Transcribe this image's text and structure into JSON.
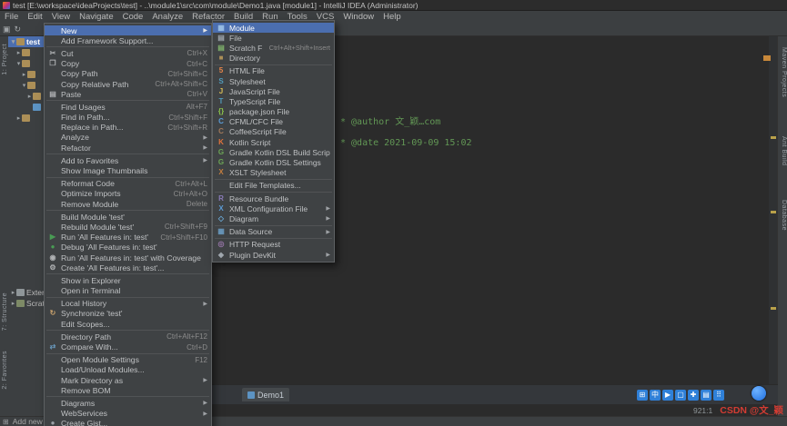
{
  "window": {
    "title": "test [E:\\workspace\\ideaProjects\\test] - ..\\module1\\src\\com\\module\\Demo1.java [module1] - IntelliJ IDEA (Administrator)"
  },
  "menu_bar": [
    "File",
    "Edit",
    "View",
    "Navigate",
    "Code",
    "Analyze",
    "Refactor",
    "Build",
    "Run",
    "Tools",
    "VCS",
    "Window",
    "Help"
  ],
  "left_stripe": [
    "1: Project",
    "7: Structure",
    "2: Favorites"
  ],
  "right_stripe": [
    "Maven Projects",
    "Ant Build",
    "Database"
  ],
  "project_panel": {
    "rows": [
      {
        "arrow": "▾",
        "icon": "folder",
        "label": "test",
        "selected": true,
        "indent": 0
      },
      {
        "arrow": "▸",
        "icon": "folder",
        "indent": 1
      },
      {
        "arrow": "▾",
        "icon": "folder",
        "indent": 1
      },
      {
        "arrow": "▸",
        "icon": "folder",
        "indent": 2
      },
      {
        "arrow": "▾",
        "icon": "folder",
        "indent": 2
      },
      {
        "arrow": "▸",
        "icon": "folder",
        "indent": 3
      },
      {
        "arrow": "",
        "icon": "file",
        "indent": 3
      },
      {
        "arrow": "▸",
        "icon": "folder",
        "indent": 1
      }
    ],
    "bottom_rows": [
      {
        "arrow": "▸",
        "icon": "lib",
        "label": "External Libraries",
        "indent": 0
      },
      {
        "arrow": "▸",
        "icon": "scratch",
        "label": "Scratches and Consoles",
        "indent": 0
      }
    ]
  },
  "context_menu": {
    "items": [
      {
        "label": "New",
        "arrow": true,
        "selected": true
      },
      {
        "label": "Add Framework Support...",
        "sep": true
      },
      {
        "label": "Cut",
        "shortcut": "Ctrl+X",
        "icon": {
          "name": "cut-icon",
          "glyph": "✂",
          "color": "#afb1b3"
        }
      },
      {
        "label": "Copy",
        "shortcut": "Ctrl+C",
        "icon": {
          "name": "copy-icon",
          "glyph": "❐",
          "color": "#afb1b3"
        }
      },
      {
        "label": "Copy Path",
        "shortcut": "Ctrl+Shift+C"
      },
      {
        "label": "Copy Relative Path",
        "shortcut": "Ctrl+Alt+Shift+C"
      },
      {
        "label": "Paste",
        "shortcut": "Ctrl+V",
        "icon": {
          "name": "paste-icon",
          "glyph": "▤",
          "color": "#afb1b3"
        },
        "sep": true
      },
      {
        "label": "Find Usages",
        "shortcut": "Alt+F7"
      },
      {
        "label": "Find in Path...",
        "shortcut": "Ctrl+Shift+F"
      },
      {
        "label": "Replace in Path...",
        "shortcut": "Ctrl+Shift+R"
      },
      {
        "label": "Analyze",
        "arrow": true
      },
      {
        "label": "Refactor",
        "arrow": true,
        "sep": true
      },
      {
        "label": "Add to Favorites",
        "arrow": true
      },
      {
        "label": "Show Image Thumbnails",
        "sep": true
      },
      {
        "label": "Reformat Code",
        "shortcut": "Ctrl+Alt+L"
      },
      {
        "label": "Optimize Imports",
        "shortcut": "Ctrl+Alt+O"
      },
      {
        "label": "Remove Module",
        "shortcut": "Delete",
        "sep": true
      },
      {
        "label": "Build Module 'test'"
      },
      {
        "label": "Rebuild Module 'test'",
        "shortcut": "Ctrl+Shift+F9"
      },
      {
        "label": "Run 'All Features in: test'",
        "shortcut": "Ctrl+Shift+F10",
        "icon": {
          "name": "run-icon",
          "glyph": "▶",
          "color": "#499c54"
        }
      },
      {
        "label": "Debug 'All Features in: test'",
        "icon": {
          "name": "debug-icon",
          "glyph": "●",
          "color": "#499c54"
        }
      },
      {
        "label": "Run 'All Features in: test' with Coverage",
        "icon": {
          "name": "coverage-icon",
          "glyph": "◉",
          "color": "#afb1b3"
        }
      },
      {
        "label": "Create 'All Features in: test'...",
        "icon": {
          "name": "create-run-configuration-icon",
          "glyph": "⚙",
          "color": "#afb1b3"
        },
        "sep": true
      },
      {
        "label": "Show in Explorer"
      },
      {
        "label": "Open in Terminal",
        "sep": true
      },
      {
        "label": "Local History",
        "arrow": true
      },
      {
        "label": "Synchronize 'test'",
        "icon": {
          "name": "synchronize-icon",
          "glyph": "↻",
          "color": "#c9a26d"
        }
      },
      {
        "label": "Edit Scopes...",
        "sep": true
      },
      {
        "label": "Directory Path",
        "shortcut": "Ctrl+Alt+F12"
      },
      {
        "label": "Compare With...",
        "shortcut": "Ctrl+D",
        "icon": {
          "name": "compare-icon",
          "glyph": "⇄",
          "color": "#6897bb"
        },
        "sep": true
      },
      {
        "label": "Open Module Settings",
        "shortcut": "F12"
      },
      {
        "label": "Load/Unload Modules..."
      },
      {
        "label": "Mark Directory as",
        "arrow": true
      },
      {
        "label": "Remove BOM",
        "sep": true
      },
      {
        "label": "Diagrams",
        "arrow": true
      },
      {
        "label": "WebServices",
        "arrow": true
      },
      {
        "label": "Create Gist...",
        "icon": {
          "name": "github-icon",
          "glyph": "●",
          "color": "#9aa0a6"
        }
      }
    ]
  },
  "new_submenu": {
    "items": [
      {
        "label": "Module",
        "selected": true,
        "icon": {
          "name": "module-icon",
          "glyph": "▦",
          "color": "#9cc1e6"
        }
      },
      {
        "label": "File",
        "icon": {
          "name": "file-icon",
          "glyph": "▤",
          "color": "#9fa6ad"
        }
      },
      {
        "label": "Scratch File",
        "shortcut": "Ctrl+Alt+Shift+Insert",
        "icon": {
          "name": "scratch-file-icon",
          "glyph": "▤",
          "color": "#80b36b"
        }
      },
      {
        "label": "Directory",
        "icon": {
          "name": "directory-icon",
          "glyph": "■",
          "color": "#ac8f57"
        },
        "sep": true
      },
      {
        "label": "HTML File",
        "icon": {
          "name": "html-file-icon",
          "glyph": "5",
          "color": "#e8864a"
        }
      },
      {
        "label": "Stylesheet",
        "icon": {
          "name": "stylesheet-icon",
          "glyph": "S",
          "color": "#519aba"
        }
      },
      {
        "label": "JavaScript File",
        "icon": {
          "name": "javascript-file-icon",
          "glyph": "J",
          "color": "#d6bb56"
        }
      },
      {
        "label": "TypeScript File",
        "icon": {
          "name": "typescript-file-icon",
          "glyph": "T",
          "color": "#519aba"
        }
      },
      {
        "label": "package.json File",
        "icon": {
          "name": "package-json-icon",
          "glyph": "{}",
          "color": "#8bc34a"
        }
      },
      {
        "label": "CFML/CFC File",
        "icon": {
          "name": "cfml-file-icon",
          "glyph": "C",
          "color": "#5b9bd5"
        }
      },
      {
        "label": "CoffeeScript File",
        "icon": {
          "name": "coffeescript-file-icon",
          "glyph": "C",
          "color": "#a1785a"
        }
      },
      {
        "label": "Kotlin Script",
        "icon": {
          "name": "kotlin-script-icon",
          "glyph": "K",
          "color": "#e0733c"
        }
      },
      {
        "label": "Gradle Kotlin DSL Build Script",
        "icon": {
          "name": "gradle-build-script-icon",
          "glyph": "G",
          "color": "#6ba455"
        }
      },
      {
        "label": "Gradle Kotlin DSL Settings",
        "icon": {
          "name": "gradle-settings-icon",
          "glyph": "G",
          "color": "#6ba455"
        }
      },
      {
        "label": "XSLT Stylesheet",
        "icon": {
          "name": "xslt-stylesheet-icon",
          "glyph": "X",
          "color": "#c27d3f"
        },
        "sep": true
      },
      {
        "label": "Edit File Templates...",
        "sep": true
      },
      {
        "label": "Resource Bundle",
        "icon": {
          "name": "resource-bundle-icon",
          "glyph": "R",
          "color": "#8a7bb8"
        }
      },
      {
        "label": "XML Configuration File",
        "arrow": true,
        "icon": {
          "name": "xml-file-icon",
          "glyph": "X",
          "color": "#5b9bd5"
        }
      },
      {
        "label": "Diagram",
        "arrow": true,
        "icon": {
          "name": "diagram-icon",
          "glyph": "◇",
          "color": "#6ba9d6"
        },
        "sep": true
      },
      {
        "label": "Data Source",
        "arrow": true,
        "icon": {
          "name": "data-source-icon",
          "glyph": "▦",
          "color": "#6897bb"
        },
        "sep": true
      },
      {
        "label": "HTTP Request",
        "icon": {
          "name": "http-request-icon",
          "glyph": "◎",
          "color": "#9876aa"
        }
      },
      {
        "label": "Plugin DevKit",
        "arrow": true,
        "icon": {
          "name": "plugin-devkit-icon",
          "glyph": "◆",
          "color": "#9fa6ad"
        }
      }
    ]
  },
  "editor": {
    "lines": [
      {
        "row": 3,
        "text": "* @author 文_颖…com"
      },
      {
        "row": 5,
        "text": "* @date 2021-09-09 15:02"
      }
    ],
    "tab_label": "Demo1"
  },
  "overlay_toolbar": {
    "icons": [
      {
        "name": "grid-icon",
        "glyph": "⊞"
      },
      {
        "name": "translate-icon",
        "glyph": "中"
      },
      {
        "name": "play-icon",
        "glyph": "▶"
      },
      {
        "name": "screen-icon",
        "glyph": "▢"
      },
      {
        "name": "plus-icon",
        "glyph": "✚"
      },
      {
        "name": "list-icon",
        "glyph": "▤"
      },
      {
        "name": "qr-code-icon",
        "glyph": "⠿"
      }
    ]
  },
  "status_bar": {
    "message": "Add new ...",
    "position": "921:1"
  },
  "watermark": "CSDN @文_颖",
  "colors": {
    "accent": "#4b6eaf",
    "comment": "#629755",
    "watermark": "#d43c33"
  }
}
